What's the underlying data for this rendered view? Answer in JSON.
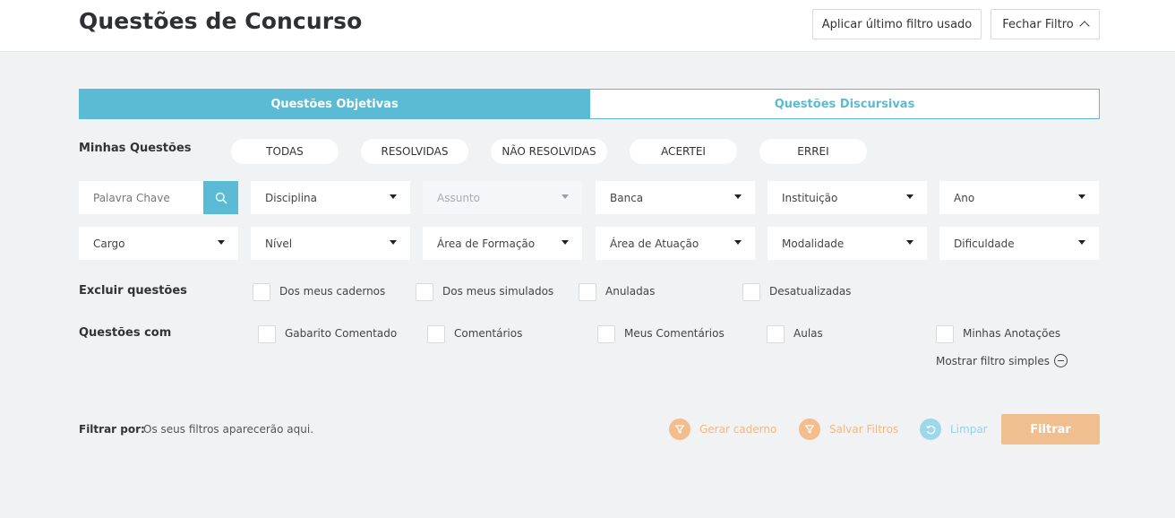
{
  "header": {
    "title": "Questões de Concurso",
    "apply_last_filter": "Aplicar último filtro usado",
    "close_filter": "Fechar Filtro"
  },
  "tabs": [
    {
      "label": "Questões Objetivas",
      "active": true
    },
    {
      "label": "Questões Discursivas",
      "active": false
    }
  ],
  "my_questions": {
    "label": "Minhas Questões",
    "options": [
      "TODAS",
      "RESOLVIDAS",
      "NÃO RESOLVIDAS",
      "ACERTEI",
      "ERREI"
    ]
  },
  "search": {
    "placeholder": "Palavra Chave"
  },
  "selects_row1": [
    "Disciplina",
    "Assunto",
    "Banca",
    "Instituição",
    "Ano"
  ],
  "selects_row2": [
    "Cargo",
    "Nível",
    "Área de Formação",
    "Área de Atuação",
    "Modalidade",
    "Dificuldade"
  ],
  "exclude": {
    "label": "Excluir questões",
    "options": [
      "Dos meus cadernos",
      "Dos meus simulados",
      "Anuladas",
      "Desatualizadas"
    ]
  },
  "with": {
    "label": "Questões com",
    "options": [
      "Gabarito Comentado",
      "Comentários",
      "Meus Comentários",
      "Aulas",
      "Minhas Anotações"
    ]
  },
  "simple_filter": "Mostrar filtro simples",
  "footer": {
    "filter_by_label": "Filtrar por:",
    "filter_hint": "Os seus filtros aparecerão aqui.",
    "gerar_caderno": "Gerar caderno",
    "salvar_filtros": "Salvar Filtros",
    "limpar": "Limpar",
    "filtrar": "Filtrar"
  },
  "colors": {
    "accent": "#5bbad4",
    "orange": "#f3bd8e",
    "light_blue": "#9fd7ea"
  }
}
